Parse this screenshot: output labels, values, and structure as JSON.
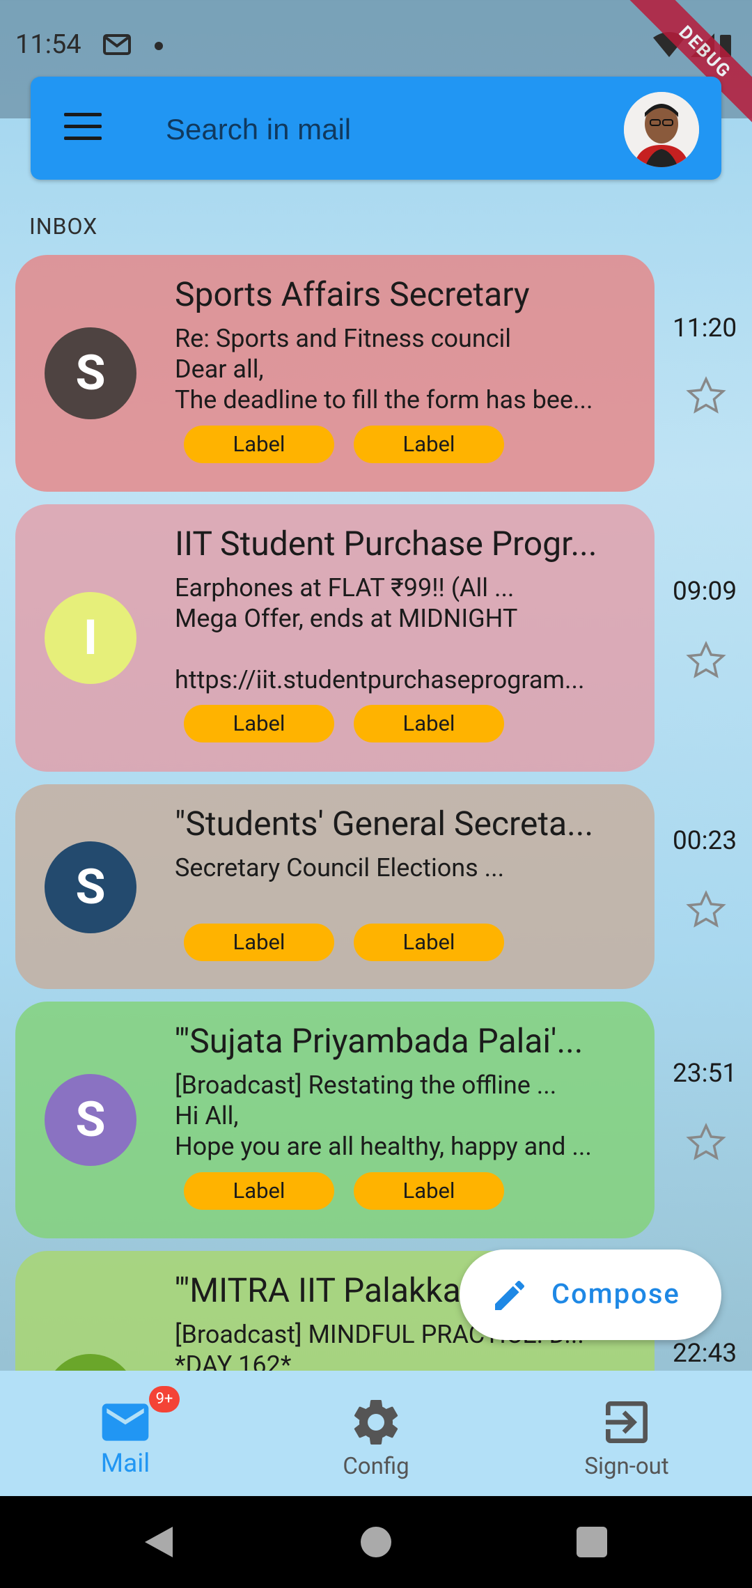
{
  "status_bar": {
    "time": "11:54",
    "debug_banner": "DEBUG"
  },
  "search": {
    "placeholder": "Search in mail"
  },
  "section_label": "INBOX",
  "mails": [
    {
      "initial": "S",
      "avatar_color": "#4e4341",
      "sender": "Sports Affairs Secretary",
      "snippet": "Re: Sports and Fitness council\nDear all,\nThe deadline to fill the form has bee...",
      "time": "11:20",
      "labels": [
        "Label",
        "Label"
      ]
    },
    {
      "initial": "I",
      "avatar_color": "#e6ef7a",
      "sender": "IIT Student Purchase Progr...",
      "snippet": "Earphones at FLAT ₹99!! (All ...\nMega Offer, ends at MIDNIGHT\n\nhttps://iit.studentpurchaseprogram...",
      "time": "09:09",
      "labels": [
        "Label",
        "Label"
      ]
    },
    {
      "initial": "S",
      "avatar_color": "#234a6e",
      "sender": "\"Students' General Secreta...",
      "snippet": "Secretary Council Elections ...",
      "time": "00:23",
      "labels": [
        "Label",
        "Label"
      ]
    },
    {
      "initial": "S",
      "avatar_color": "#8a72c2",
      "sender": "'\"Sujata Priyambada Palai'...",
      "snippet": "[Broadcast] Restating the offline ...\nHi All,\nHope you are all healthy, happy and ...",
      "time": "23:51",
      "labels": [
        "Label",
        "Label"
      ]
    },
    {
      "initial": "",
      "avatar_color": "#6aa62a",
      "sender": "'\"MITRA IIT Palakka",
      "snippet": "[Broadcast] MINDFUL PRACTICE: D...\n*DAY 162*",
      "time": "22:43",
      "labels": []
    }
  ],
  "fab": {
    "label": "Compose"
  },
  "bottom_nav": {
    "mail": {
      "label": "Mail",
      "badge": "9+"
    },
    "config": {
      "label": "Config"
    },
    "signout": {
      "label": "Sign-out"
    }
  },
  "colors": {
    "primary": "#2196f3",
    "chip": "#ffb300",
    "badge": "#f44336"
  }
}
